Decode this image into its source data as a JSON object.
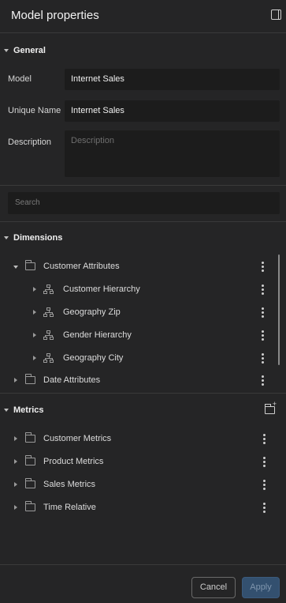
{
  "header": {
    "title": "Model properties",
    "panel_icon": "panel-toggle-icon"
  },
  "general": {
    "title": "General",
    "model_label": "Model",
    "model_value": "Internet Sales",
    "unique_name_label": "Unique Name",
    "unique_name_value": "Internet Sales",
    "description_label": "Description",
    "description_placeholder": "Description"
  },
  "search": {
    "placeholder": "Search"
  },
  "dimensions": {
    "title": "Dimensions",
    "items": [
      {
        "label": "Customer Attributes",
        "icon": "folder-icon",
        "expanded": true
      },
      {
        "label": "Customer Hierarchy",
        "icon": "hierarchy-icon"
      },
      {
        "label": "Geography Zip",
        "icon": "hierarchy-icon"
      },
      {
        "label": "Gender Hierarchy",
        "icon": "hierarchy-icon"
      },
      {
        "label": "Geography City",
        "icon": "hierarchy-icon"
      },
      {
        "label": "Date Attributes",
        "icon": "folder-icon"
      }
    ]
  },
  "metrics": {
    "title": "Metrics",
    "add_icon": "add-folder-icon",
    "items": [
      {
        "label": "Customer Metrics",
        "icon": "folder-icon"
      },
      {
        "label": "Product Metrics",
        "icon": "folder-icon"
      },
      {
        "label": "Sales Metrics",
        "icon": "folder-icon"
      },
      {
        "label": "Time Relative",
        "icon": "folder-icon"
      }
    ]
  },
  "footer": {
    "cancel_label": "Cancel",
    "apply_label": "Apply"
  },
  "colors": {
    "background": "#252526",
    "input_bg": "#1c1c1c",
    "apply_bg": "#33506f"
  }
}
